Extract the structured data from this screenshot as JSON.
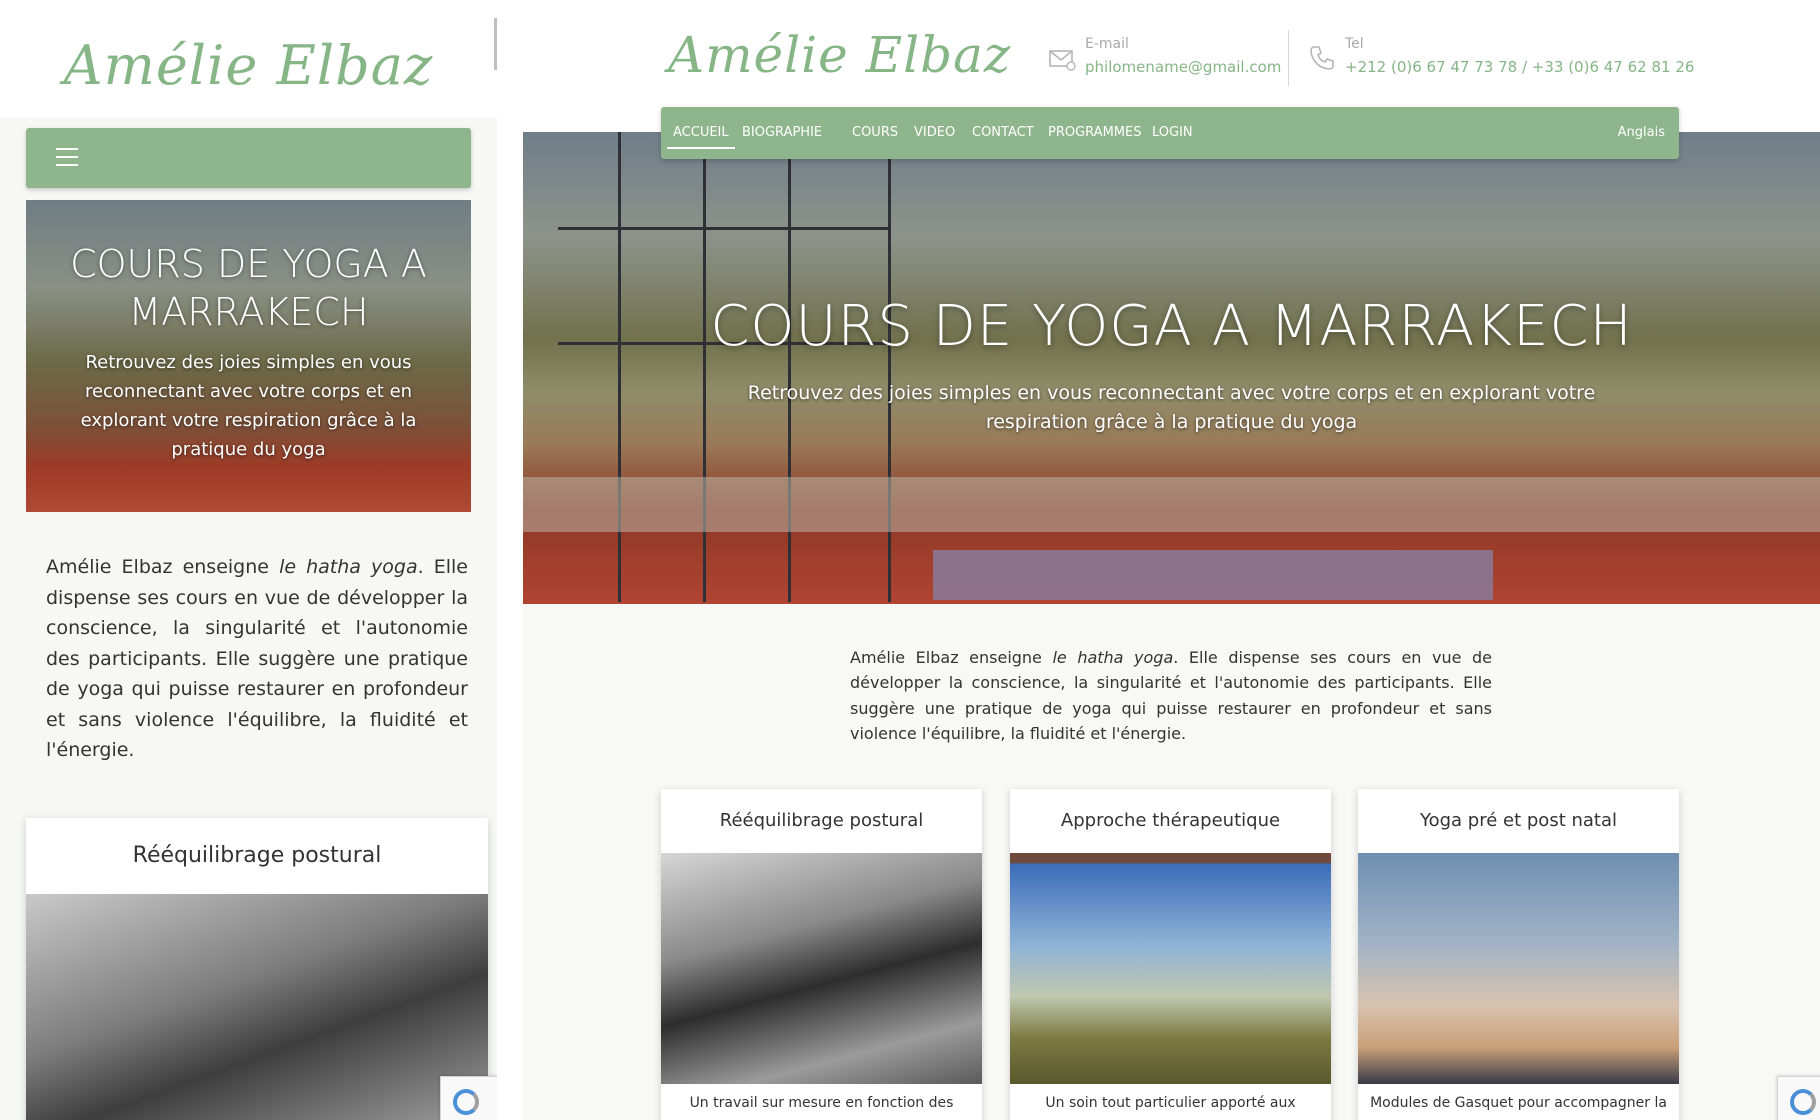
{
  "brand": {
    "name": "Amélie Elbaz",
    "accent": "#8fb58c",
    "logo_color": "#86b586"
  },
  "header": {
    "email_label": "E-mail",
    "email_value": "philomename@gmail.com",
    "tel_label": "Tel",
    "tel_value": "+212 (0)6 67 47 73 78 / +33 (0)6 47 62 81 26"
  },
  "nav": {
    "items": [
      "ACCUEIL",
      "BIOGRAPHIE",
      "COURS",
      "VIDEO",
      "CONTACT",
      "PROGRAMMES",
      "LOGIN"
    ],
    "active": "ACCUEIL",
    "language": "Anglais",
    "menu_icon": "hamburger-icon"
  },
  "hero": {
    "title": "COURS DE YOGA A MARRAKECH",
    "subtitle": "Retrouvez des joies simples en vous reconnectant avec votre corps et en explorant votre respiration grâce à la pratique du yoga"
  },
  "intro": {
    "before": "Amélie Elbaz enseigne ",
    "emphasis": "le hatha yoga",
    "after": ". Elle dispense ses cours en vue de développer la conscience, la singularité et l'autonomie des participants. Elle suggère une pratique de yoga qui puisse restaurer en profondeur et sans violence l'équilibre, la fluidité et l'énergie."
  },
  "cards": [
    {
      "title": "Rééquilibrage postural",
      "text": "Un travail sur mesure en fonction des"
    },
    {
      "title": "Approche thérapeutique",
      "text": "Un soin tout particulier apporté aux"
    },
    {
      "title": "Yoga pré et post natal",
      "text": "Modules de Gasquet pour accompagner la"
    }
  ],
  "icons": {
    "email": "envelope-icon",
    "phone": "phone-icon",
    "recaptcha": "recaptcha-icon"
  }
}
